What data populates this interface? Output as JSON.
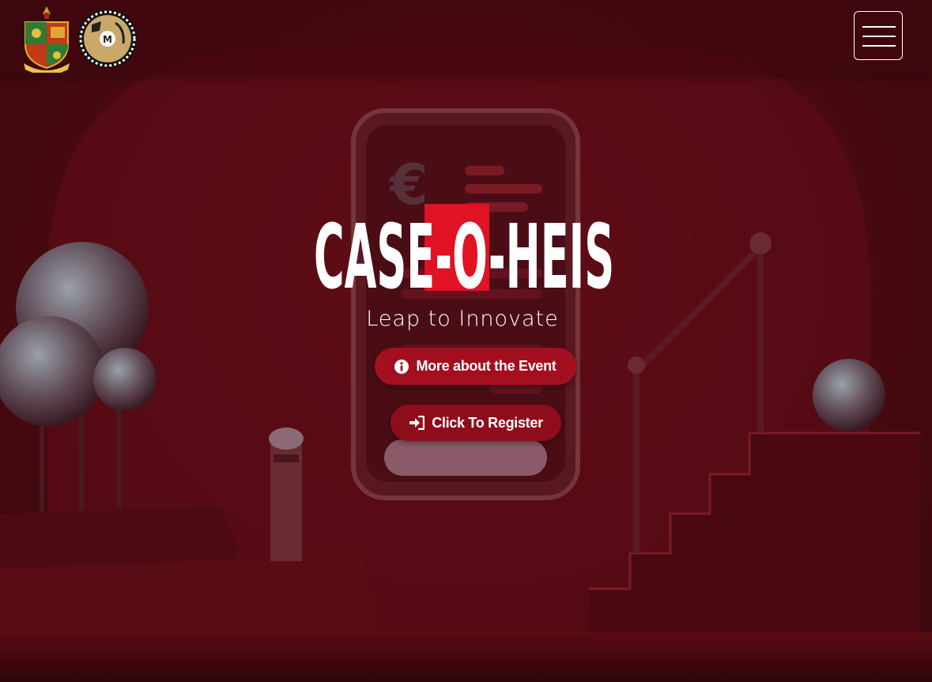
{
  "header": {
    "logos": [
      {
        "icon": "college-crest-icon"
      },
      {
        "icon": "club-emblem-icon"
      }
    ],
    "menu_icon": "hamburger-menu-icon"
  },
  "hero": {
    "brand": {
      "part1": "CASE",
      "part2": "-O-",
      "part3": "HEIST"
    },
    "tagline": "Leap to Innovate",
    "buttons": {
      "more": {
        "label": "More about the Event",
        "icon": "info-circle-icon"
      },
      "register": {
        "label": "Click To Register",
        "icon": "sign-in-icon"
      }
    }
  },
  "colors": {
    "background": "#4a0a10",
    "brand_red": "#e01224",
    "button_primary": "#a30f1e",
    "button_secondary": "#8e0d1b",
    "text": "#ffffff"
  }
}
